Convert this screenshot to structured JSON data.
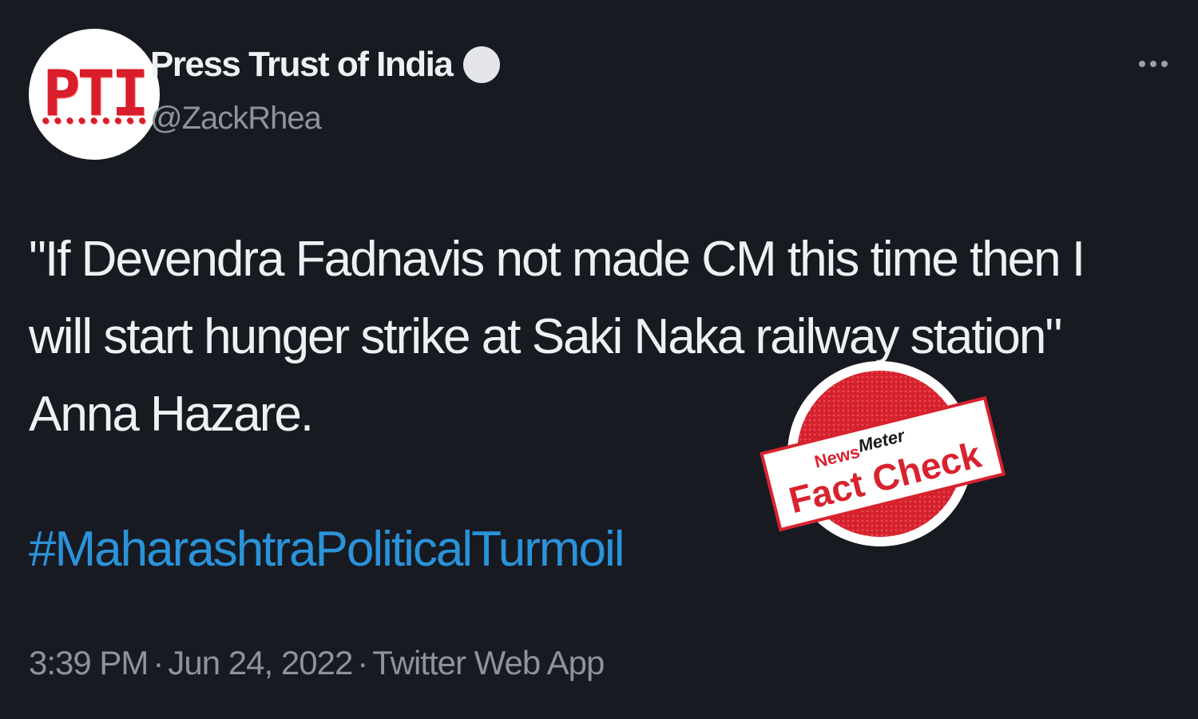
{
  "tweet": {
    "author": {
      "display_name": "Press Trust of India",
      "handle": "@ZackRhea",
      "avatar_text": "PTI"
    },
    "text_lines": [
      "\"If Devendra Fadnavis not made CM this time then I",
      "will start hunger strike at Saki Naka railway station\"",
      "Anna Hazare."
    ],
    "hashtag": "#MaharashtraPoliticalTurmoil",
    "time": "3:39 PM",
    "date": "Jun 24, 2022",
    "source": "Twitter Web App",
    "separator": "·"
  },
  "stamp": {
    "brand_news": "News",
    "brand_meter": "Meter",
    "label": "Fact Check"
  },
  "colors": {
    "background": "#181a22",
    "hashtag": "#2a93d9",
    "stamp_red": "#d8232f"
  },
  "icons": {
    "verified": "verified-badge-icon",
    "more": "more-options-icon"
  }
}
